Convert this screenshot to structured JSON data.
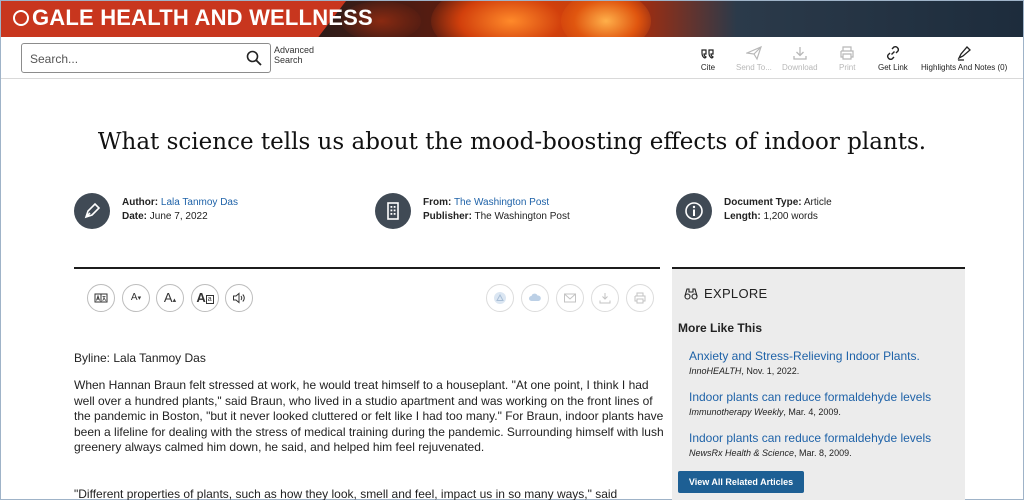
{
  "banner": {
    "title": "GALE HEALTH AND WELLNESS"
  },
  "search": {
    "placeholder": "Search...",
    "advanced_line1": "Advanced",
    "advanced_line2": "Search"
  },
  "toolbar": {
    "cite": "Cite",
    "send_to": "Send To...",
    "download": "Download",
    "print": "Print",
    "get_link": "Get Link",
    "highlights": "Highlights And Notes (0)"
  },
  "document": {
    "title": "What science tells us about the mood-boosting effects of indoor plants.",
    "author_label": "Author:",
    "author": "Lala Tanmoy Das",
    "date_label": "Date:",
    "date": "June 7, 2022",
    "from_label": "From:",
    "from": "The Washington Post",
    "publisher_label": "Publisher:",
    "publisher": "The Washington Post",
    "doctype_label": "Document Type:",
    "doctype": "Article",
    "length_label": "Length:",
    "length": "1,200 words"
  },
  "reader_tools": {
    "font_a": "A",
    "translate_icon": "translate-icon",
    "listen_icon": "speaker-icon"
  },
  "body": {
    "byline": "Byline: Lala Tanmoy Das",
    "para1": "When Hannan Braun felt stressed at work, he would treat himself to a houseplant. \"At one point, I think I had well over a hundred plants,\" said Braun, who lived in a studio apartment and was working on the front lines of the pandemic in Boston, \"but it never looked cluttered or felt like I had too many.\" For Braun, indoor plants have been a lifeline for dealing with the stress of medical training during the pandemic. Surrounding himself with lush greenery always calmed him down, he said, and helped him feel rejuvenated.",
    "para2": "\"Different properties of plants, such as how they look, smell and feel, impact us in so many ways,\" said"
  },
  "explore": {
    "heading": "EXPLORE",
    "more_like_this": "More Like This",
    "items": [
      {
        "title": "Anxiety and Stress-Relieving Indoor Plants.",
        "source": "InnoHEALTH",
        "date": ", Nov. 1, 2022."
      },
      {
        "title": "Indoor plants can reduce formaldehyde levels",
        "source": "Immunotherapy Weekly",
        "date": ", Mar. 4, 2009."
      },
      {
        "title": "Indoor plants can reduce formaldehyde levels",
        "source": "NewsRx Health & Science",
        "date": ", Mar. 8, 2009."
      }
    ],
    "view_all": "View All Related Articles"
  },
  "colors": {
    "brand_red": "#c8361e",
    "link_blue": "#1e62a8",
    "button_blue": "#1d5f94",
    "icon_dark": "#404a55"
  }
}
